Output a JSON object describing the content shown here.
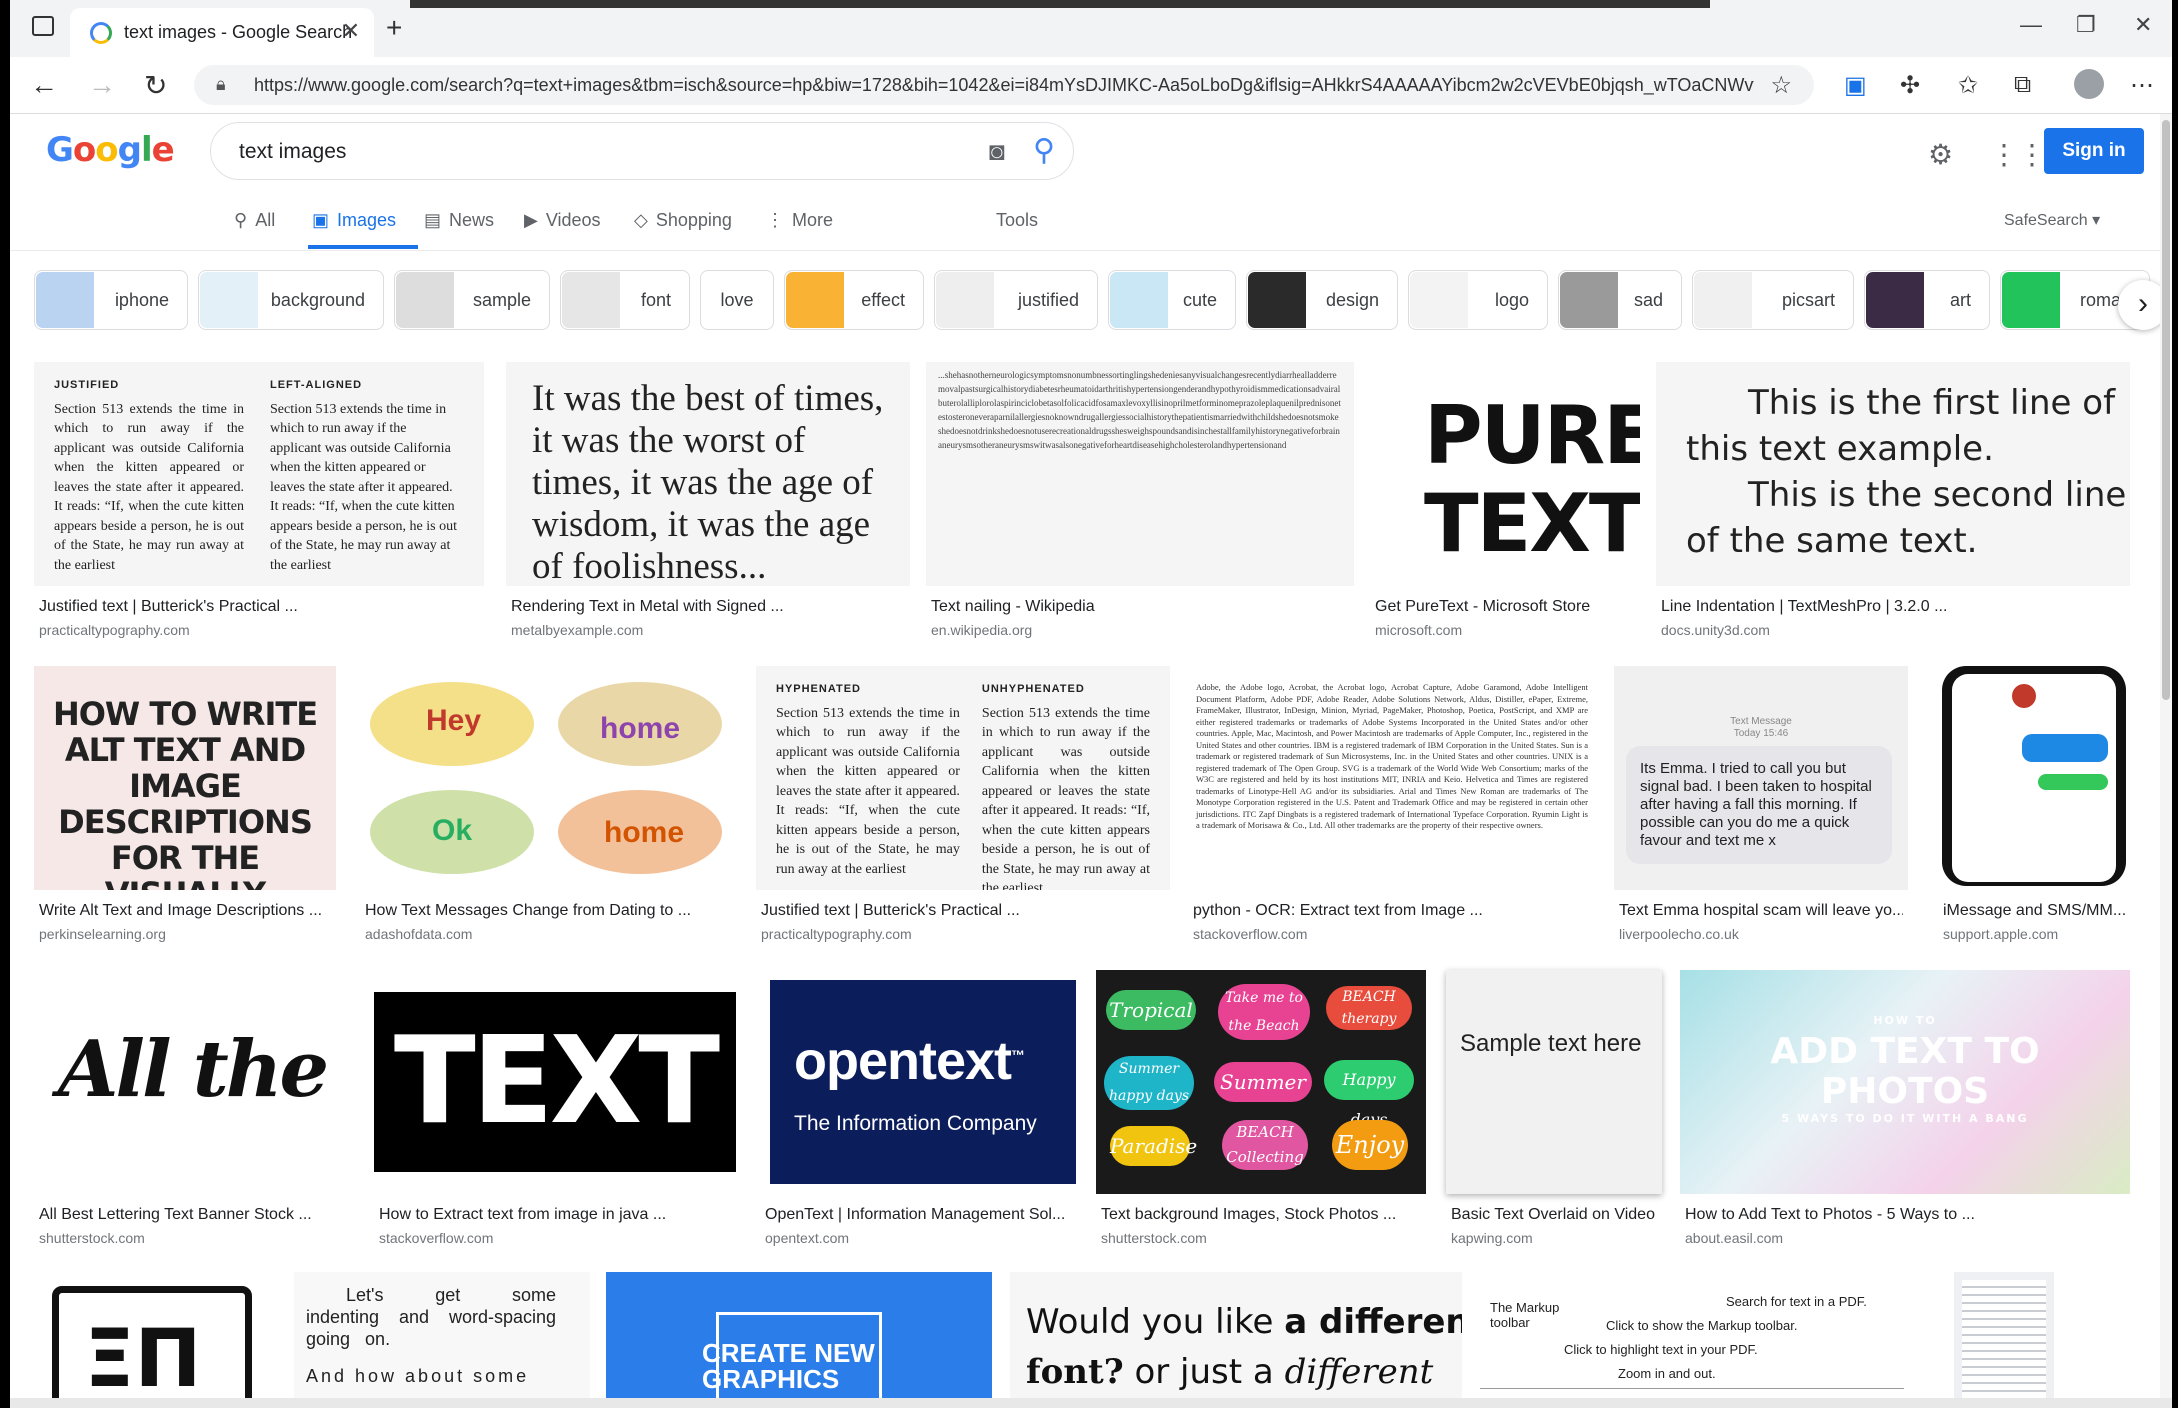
{
  "browser": {
    "tab_title": "text images - Google Search",
    "url": "https://www.google.com/search?q=text+images&tbm=isch&source=hp&biw=1728&bih=1042&ei=i84mYsDJIMKC-Aa5oLboDg&iflsig=AHkkrS4AAAAAYibcm2w2cVEVbE0bjqsh_wTOaCNWvy0f&..."
  },
  "header": {
    "query": "text images",
    "signin_label": "Sign in"
  },
  "nav": {
    "all": "All",
    "images": "Images",
    "news": "News",
    "videos": "Videos",
    "shopping": "Shopping",
    "more": "More",
    "tools": "Tools",
    "safesearch": "SafeSearch"
  },
  "chips": [
    {
      "label": "iphone",
      "color": "#b9d3f0"
    },
    {
      "label": "background",
      "color": "#e4f0f8"
    },
    {
      "label": "sample",
      "color": "#dddddd"
    },
    {
      "label": "font",
      "color": "#e6e6e6"
    },
    {
      "label": "love",
      "color": ""
    },
    {
      "label": "effect",
      "color": "#f9b233"
    },
    {
      "label": "justified",
      "color": "#eeeeee"
    },
    {
      "label": "cute",
      "color": "#c9e7f5"
    },
    {
      "label": "design",
      "color": "#2a2a2a"
    },
    {
      "label": "logo",
      "color": "#f3f3f3"
    },
    {
      "label": "sad",
      "color": "#9a9a9a"
    },
    {
      "label": "picsart",
      "color": "#f0f0f0"
    },
    {
      "label": "art",
      "color": "#3b2b45"
    },
    {
      "label": "roman",
      "color": "#22c35a"
    }
  ],
  "results": {
    "r1": [
      {
        "title": "Justified text | Butterick's Practical ...",
        "source": "practicaltypography.com"
      },
      {
        "title": "Rendering Text in Metal with Signed ...",
        "source": "metalbyexample.com"
      },
      {
        "title": "Text nailing - Wikipedia",
        "source": "en.wikipedia.org"
      },
      {
        "title": "Get PureText - Microsoft Store",
        "source": "microsoft.com"
      },
      {
        "title": "Line Indentation | TextMeshPro | 3.2.0 ...",
        "source": "docs.unity3d.com"
      }
    ],
    "r2": [
      {
        "title": "Write Alt Text and Image Descriptions ...",
        "source": "perkinselearning.org"
      },
      {
        "title": "How Text Messages Change from Dating to ...",
        "source": "adashofdata.com"
      },
      {
        "title": "Justified text | Butterick's Practical ...",
        "source": "practicaltypography.com"
      },
      {
        "title": "python - OCR: Extract text from Image ...",
        "source": "stackoverflow.com"
      },
      {
        "title": "Text Emma hospital scam will leave yo...",
        "source": "liverpoolecho.co.uk"
      },
      {
        "title": "iMessage and SMS/MM...",
        "source": "support.apple.com"
      }
    ],
    "r3": [
      {
        "title": "All Best Lettering Text Banner Stock ...",
        "source": "shutterstock.com"
      },
      {
        "title": "How to Extract text from image in java ...",
        "source": "stackoverflow.com"
      },
      {
        "title": "OpenText | Information Management Sol...",
        "source": "opentext.com"
      },
      {
        "title": "Text background Images, Stock Photos ...",
        "source": "shutterstock.com"
      },
      {
        "title": "Basic Text Overlaid on Video",
        "source": "kapwing.com"
      },
      {
        "title": "How to Add Text to Photos - 5 Ways to ...",
        "source": "about.easil.com"
      }
    ]
  },
  "thumbs": {
    "justified_label": "JUSTIFIED",
    "leftaligned_label": "LEFT-ALIGNED",
    "hyphenated_label": "HYPHENATED",
    "unhyphenated_label": "UNHYPHENATED",
    "section_text": "Section 513 extends the time in which to run away if the applicant was outside California when the kitten appeared or leaves the state after it appeared. It reads: “If, when the cute kitten appears beside a person, he is out of the State, he may run away at the earliest",
    "dickens": "It was the best of times, it was the worst of times, it was the age of wisdom, it was the age of foolishness...",
    "nailing": "...shehasnotherneurologicsymptomsnonumbnessortinglingshedeniesanyvisualchangesrecentlydiarrhealladderremovalpastsurgicalhistorydiabetesrheumatoidarthritishypertensiongenderandhypothyroidismmedicationsadvairalbuterolalliplorolaspirinciclobetasolfolicacidfosamaxlevoxyllisinoprilmetforminomeprazoleplaquenilprednisonetestosteroneveraparnilallergiesnoknowndrugallergiessocialhistorythepatientismarriedwithchildshedoesnotsmokeshedoesnotdrinkshedoesnotuserecreationaldrugsshesweighspoundsandisinchestallfamilyhistorynegativeforbrainaneurysmsotheraneurysmswitwasalsonegativeforheartdiseasehighcholesterolandhypertensionand",
    "pure": "PURE TEXT",
    "indent_line1": "This is the first line of",
    "indent_line2": "this text example.",
    "indent_line3": "This is the second line",
    "indent_line4": "of the same text.",
    "alt": "HOW TO WRITE ALT TEXT AND IMAGE DESCRIPTIONS FOR THE VISUALLY IMPAIRED",
    "ocr": "Adobe, the Adobe logo, Acrobat, the Acrobat logo, Acrobat Capture, Adobe Garamond, Adobe Intelligent Document Platform, Adobe PDF, Adobe Reader, Adobe Solutions Network, Aldus, Distiller, ePaper, Extreme, FrameMaker, Illustrator, InDesign, Minion, Myriad, PageMaker, Photoshop, Poetica, PostScript, and XMP are either registered trademarks or trademarks of Adobe Systems Incorporated in the United States and/or other countries. Apple, Mac, Macintosh, and Power Macintosh are trademarks of Apple Computer, Inc., registered in the United States and other countries. IBM is a registered trademark of IBM Corporation in the United States. Sun is a trademark or registered trademark of Sun Microsystems, Inc. in the United States and other countries. UNIX is a registered trademark of The Open Group. SVG is a trademark of the World Wide Web Consortium; marks of the W3C are registered and held by its host institutions MIT, INRIA and Keio. Helvetica and Times are registered trademarks of Linotype-Hell AG and/or its subsidiaries. Arial and Times New Roman are trademarks of The Monotype Corporation registered in the U.S. Patent and Trademark Office and may be registered in certain other jurisdictions. ITC Zapf Dingbats is a registered trademark of International Typeface Corporation. Ryumin Light is a trademark of Morisawa & Co., Ltd. All other trademarks are the property of their respective owners.",
    "sms_header": "Text Message",
    "sms_time": "Today 15:46",
    "sms": "Its Emma. I tried to call you but signal bad. I been taken to hospital after having a fall this morning. If possible can you do me a quick favour and text me x",
    "allbest": "All the Best!",
    "text": "TEXT",
    "opentext": "opentext",
    "opentext_tm": "™",
    "opentext_sub": "The Information Company",
    "brush_tropical": "Tropical",
    "brush_beach1": "Take me to the Beach",
    "brush_beach2": "BEACH therapy",
    "brush_summer1": "Summer happy days",
    "brush_summer2": "Summer",
    "brush_happy": "Happy days",
    "brush_beach3": "BEACH Collecting",
    "brush_paradise": "Paradise",
    "brush_enjoy": "Enjoy",
    "sample": "Sample text here",
    "photo_small_top": "HOW TO",
    "photo_big": "ADD TEXT TO PHOTOS",
    "photo_small": "5 WAYS TO DO IT WITH A BANG",
    "spacing1": "Let's get some indenting and word-spacing going on.",
    "spacing2": "And how about some",
    "create": "CREATE NEW GRAPHICS",
    "diff1": "Would you like",
    "diff1b": "a different",
    "diff2": "font?",
    "diff2b": "or just a",
    "diff2c": "different",
    "markup_toolbar": "The Markup toolbar",
    "markup_search": "Search for text in a PDF.",
    "markup_click": "Click to show the Markup toolbar.",
    "markup_highlight": "Click to highlight text in your PDF.",
    "markup_zoom": "Zoom in and out."
  }
}
